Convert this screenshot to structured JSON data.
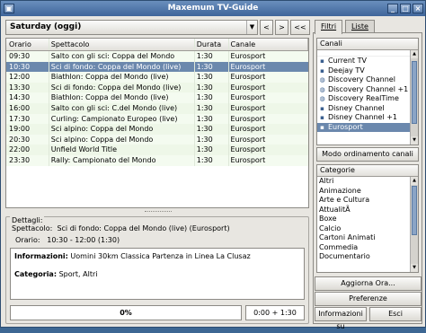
{
  "window": {
    "title": "Maxemum TV-Guide"
  },
  "toolbar": {
    "day": "Saturday (oggi)",
    "prev": "<",
    "next": ">",
    "extra": "<<"
  },
  "schedule": {
    "headers": [
      "Orario",
      "Spettacolo",
      "Durata",
      "Canale"
    ],
    "rows": [
      [
        "09:30",
        "Salto con gli sci: Coppa del Mondo",
        "1:30",
        "Eurosport"
      ],
      [
        "10:30",
        "Sci di fondo: Coppa del Mondo (live)",
        "1:30",
        "Eurosport"
      ],
      [
        "12:00",
        "Biathlon: Coppa del Mondo (live)",
        "1:30",
        "Eurosport"
      ],
      [
        "13:30",
        "Sci di fondo: Coppa del Mondo (live)",
        "1:30",
        "Eurosport"
      ],
      [
        "14:30",
        "Biathlon: Coppa del Mondo (live)",
        "1:30",
        "Eurosport"
      ],
      [
        "16:00",
        "Salto con gli sci: C.del Mondo (live)",
        "1:30",
        "Eurosport"
      ],
      [
        "17:30",
        "Curling: Campionato Europeo (live)",
        "1:30",
        "Eurosport"
      ],
      [
        "19:00",
        "Sci alpino: Coppa del Mondo",
        "1:30",
        "Eurosport"
      ],
      [
        "20:30",
        "Sci alpino: Coppa del Mondo",
        "1:30",
        "Eurosport"
      ],
      [
        "22:00",
        "Unfield World Title",
        "1:30",
        "Eurosport"
      ],
      [
        "23:30",
        "Rally: Campionato del Mondo",
        "1:30",
        "Eurosport"
      ]
    ],
    "selected_index": 1
  },
  "details": {
    "legend": "Dettagli:",
    "show_label": "Spettacolo:",
    "show_value": "Sci di fondo: Coppa del Mondo (live)  (Eurosport)",
    "time_label": "Orario:",
    "time_value": "10:30 - 12:00  (1:30)",
    "info_label": "Informazioni:",
    "info_value": "Uomini 30km Classica Partenza in Linea La Clusaz",
    "cat_label": "Categoria:",
    "cat_value": "Sport, Altri",
    "progress_text": "0%",
    "progress_fraction": 0.0,
    "elapsed": "0:00 + 1:30"
  },
  "sidebar": {
    "tabs": [
      "Filtri",
      "Liste"
    ],
    "channels_header": "Canali",
    "channels": [
      {
        "name": "Current TV",
        "icon": "tv-icon"
      },
      {
        "name": "Deejay TV",
        "icon": "tv-icon"
      },
      {
        "name": "Discovery Channel",
        "icon": "globe-icon"
      },
      {
        "name": "Discovery Channel +1",
        "icon": "globe-icon"
      },
      {
        "name": "Discovery RealTime",
        "icon": "globe-icon"
      },
      {
        "name": "Disney Channel",
        "icon": "tv-icon"
      },
      {
        "name": "Disney Channel +1",
        "icon": "tv-icon"
      },
      {
        "name": "Eurosport",
        "icon": "tv-icon"
      }
    ],
    "channels_selected": 7,
    "mode_button": "Modo ordinamento canali",
    "categories_header": "Categorie",
    "categories": [
      "Altri",
      "Animazione",
      "Arte e Cultura",
      "AttualitÃ",
      "Boxe",
      "Calcio",
      "Cartoni Animati",
      "Commedia",
      "Documentario"
    ],
    "update_button": "Aggiorna Ora...",
    "prefs_button": "Preferenze",
    "info_button": "Informazioni su",
    "exit_button": "Esci"
  },
  "colors": {
    "selection": "#6b88ad",
    "titlebar": "#4f74a6",
    "row_bg": "#f4fbf0"
  }
}
